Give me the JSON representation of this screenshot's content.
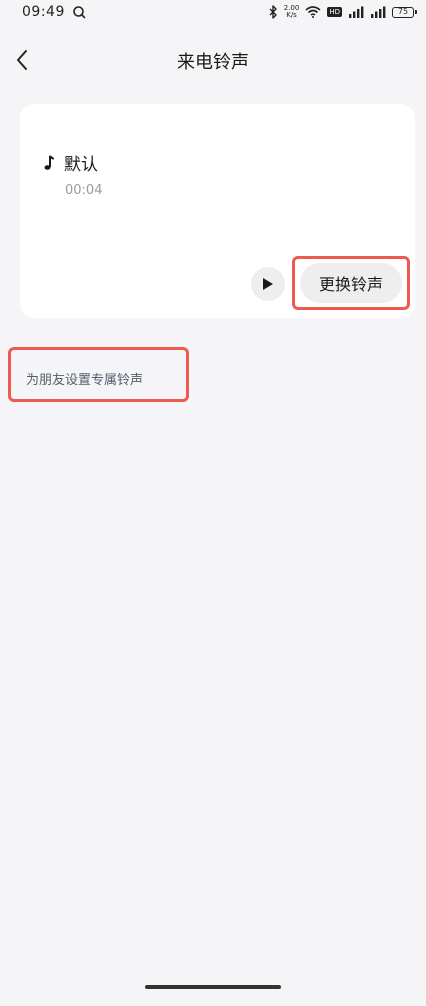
{
  "status_bar": {
    "time": "09:49",
    "network_speed_value": "2.00",
    "network_speed_unit": "K/s",
    "hd_label": "HD",
    "battery": "75"
  },
  "header": {
    "title": "来电铃声"
  },
  "ringtone": {
    "name": "默认",
    "duration": "00:04",
    "change_label": "更换铃声"
  },
  "friend_ringtone_link": "为朋友设置专属铃声",
  "colors": {
    "background": "#f5f5f7",
    "card": "#ffffff",
    "highlight_border": "#ee5a52",
    "button_bg": "#eeeeee"
  }
}
